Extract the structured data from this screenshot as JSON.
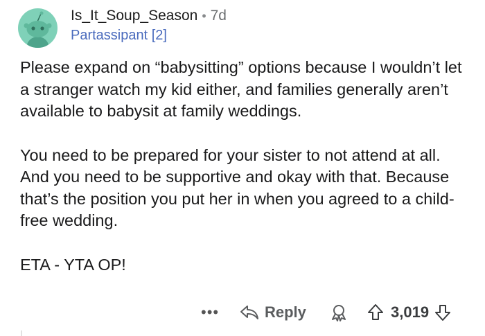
{
  "comment": {
    "author": "Is_It_Soup_Season",
    "separator": "•",
    "age": "7d",
    "flair": "Partassipant [2]",
    "paragraphs": [
      "Please expand on  “babysitting” options because I wouldn’t let a stranger watch my kid either, and families generally aren’t available to babysit at family weddings.",
      "You need to be prepared for your sister to not attend at all. And you need to be supportive and okay with that. Because that’s the position you put her in when you agreed to a child-free wedding.",
      "ETA - YTA OP!"
    ]
  },
  "actions": {
    "more_label": "•••",
    "reply_label": "Reply",
    "score": "3,019"
  },
  "colors": {
    "avatar_bg": "#7fd1b8",
    "flair": "#4a6bbd"
  },
  "icons": [
    "avatar-snoo",
    "reply-arrow-icon",
    "award-icon",
    "upvote-arrow-icon",
    "downvote-arrow-icon"
  ]
}
